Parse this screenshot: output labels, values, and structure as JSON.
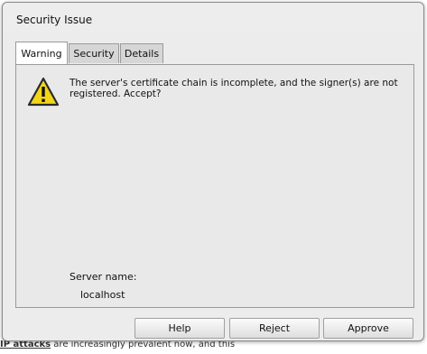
{
  "dialog": {
    "title": "Security Issue"
  },
  "tabs": [
    {
      "label": "Warning",
      "active": true
    },
    {
      "label": "Security",
      "active": false
    },
    {
      "label": "Details",
      "active": false
    }
  ],
  "warning": {
    "icon": "warning-icon",
    "message": "The server's certificate chain is incomplete, and the signer(s) are not registered. Accept?",
    "server_label": "Server name:",
    "server_value": "localhost"
  },
  "buttons": {
    "help": "Help",
    "reject": "Reject",
    "approve": "Approve"
  },
  "background": {
    "text_bold": "IP attacks",
    "text_rest": " are increasingly prevalent now, and this"
  },
  "colors": {
    "warning_yellow": "#f2d51a",
    "dialog_bg": "#ececec"
  }
}
